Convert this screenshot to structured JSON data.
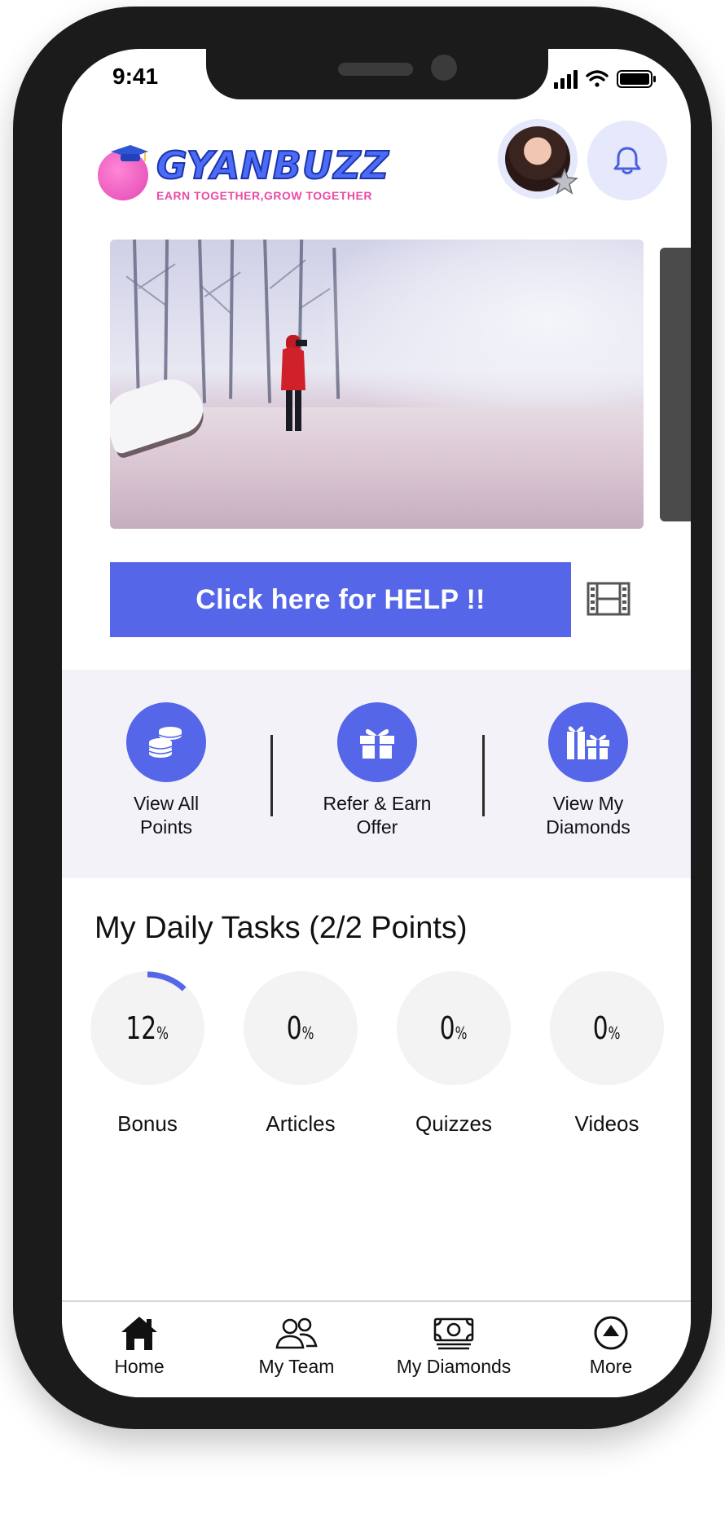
{
  "status_bar": {
    "time": "9:41"
  },
  "header": {
    "logo_word": "GYANBUZZ",
    "logo_tagline": "EARN TOGETHER,GROW TOGETHER",
    "avatar_icon": "user-avatar",
    "notification_icon": "bell-icon"
  },
  "banner": {
    "image": "snowy-field-photo"
  },
  "help": {
    "button_label": "Click here for HELP !!",
    "video_icon": "film-icon"
  },
  "quick_actions": [
    {
      "label": "View All\nPoints",
      "icon": "coins-icon"
    },
    {
      "label": "Refer & Earn\nOffer",
      "icon": "gift-icon"
    },
    {
      "label": "View My\nDiamonds",
      "icon": "gifts-icon"
    }
  ],
  "tasks": {
    "title": "My Daily Tasks (2/2 Points)",
    "items": [
      {
        "label": "Bonus",
        "value": "12",
        "unit": "%",
        "progress": 12
      },
      {
        "label": "Articles",
        "value": "0",
        "unit": "%",
        "progress": 0
      },
      {
        "label": "Quizzes",
        "value": "0",
        "unit": "%",
        "progress": 0
      },
      {
        "label": "Videos",
        "value": "0",
        "unit": "%",
        "progress": 0
      }
    ]
  },
  "tabbar": [
    {
      "label": "Home",
      "icon": "home-icon"
    },
    {
      "label": "My Team",
      "icon": "team-icon"
    },
    {
      "label": "My Diamonds",
      "icon": "money-icon"
    },
    {
      "label": "More",
      "icon": "more-icon"
    }
  ],
  "colors": {
    "accent": "#5566e8",
    "soft_accent": "#e6e8fb",
    "panel": "#f3f2f9"
  }
}
